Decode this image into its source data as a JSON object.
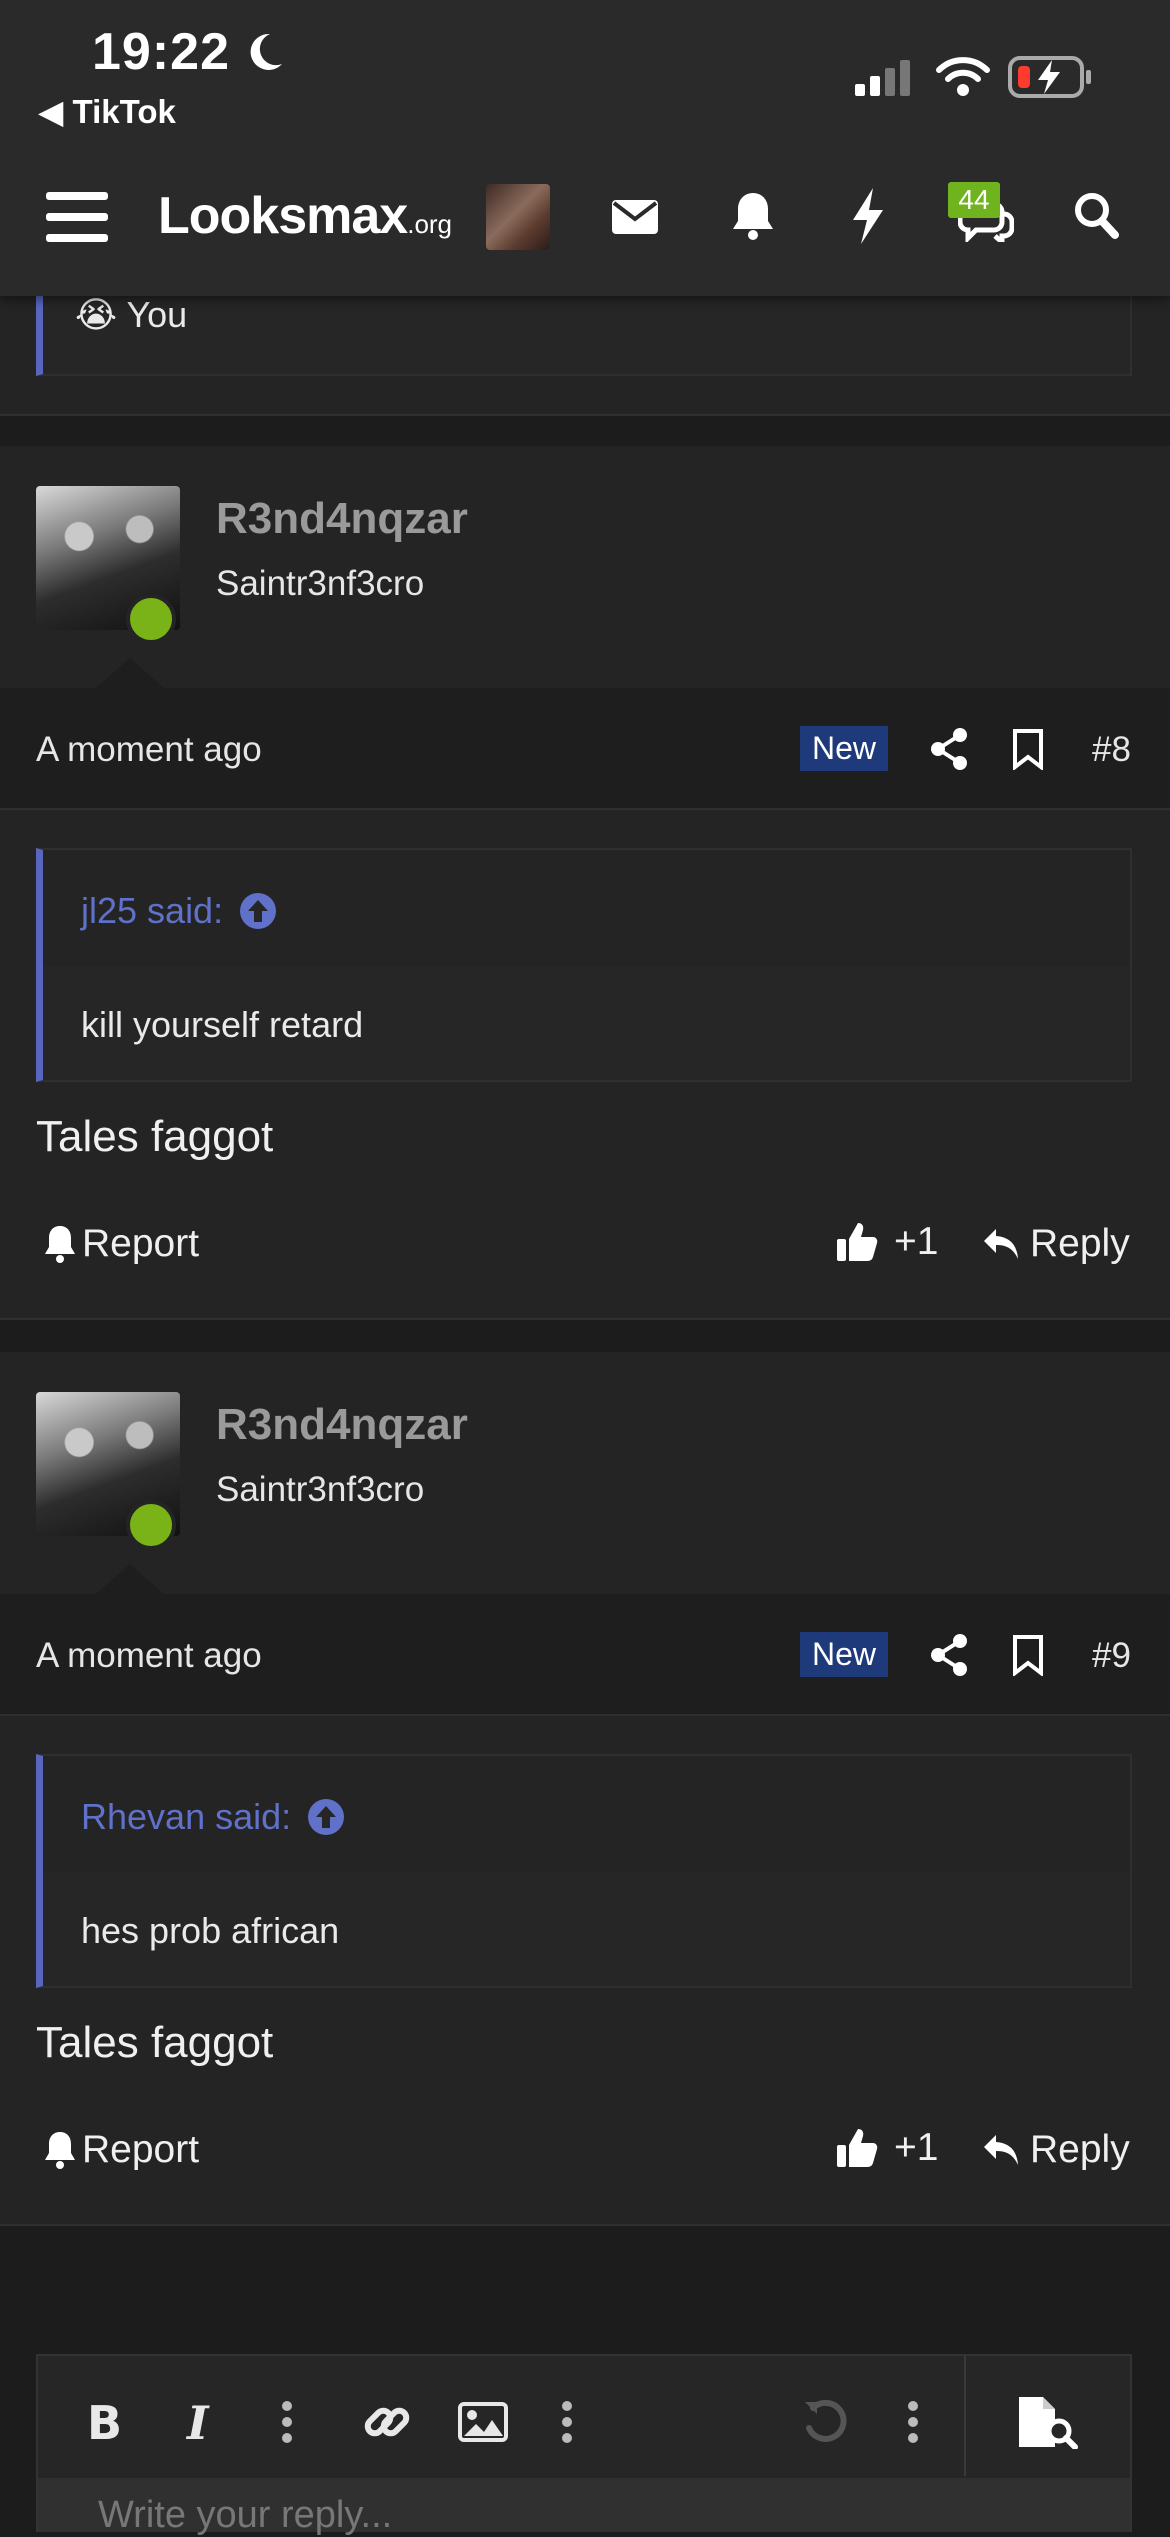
{
  "status_bar": {
    "time": "19:22",
    "back_label": "◀ TikTok"
  },
  "header": {
    "logo_main": "Looksmax",
    "logo_suffix": ".org",
    "chat_badge": "44"
  },
  "top_quote": {
    "emoji": "😭",
    "text": "You"
  },
  "posts": [
    {
      "username": "R3nd4nqzar",
      "user_title": "Saintr3nf3cro",
      "time": "A moment ago",
      "new_label": "New",
      "number": "#8",
      "quote_author": "jl25 said:",
      "quote_text": "kill yourself retard",
      "message": "Tales faggot",
      "report_label": "Report",
      "like_label": "+1",
      "reply_label": "Reply"
    },
    {
      "username": "R3nd4nqzar",
      "user_title": "Saintr3nf3cro",
      "time": "A moment ago",
      "new_label": "New",
      "number": "#9",
      "quote_author": "Rhevan said:",
      "quote_text": "hes prob african",
      "message": "Tales faggot",
      "report_label": "Report",
      "like_label": "+1",
      "reply_label": "Reply"
    }
  ],
  "editor": {
    "placeholder": "Write your reply..."
  }
}
